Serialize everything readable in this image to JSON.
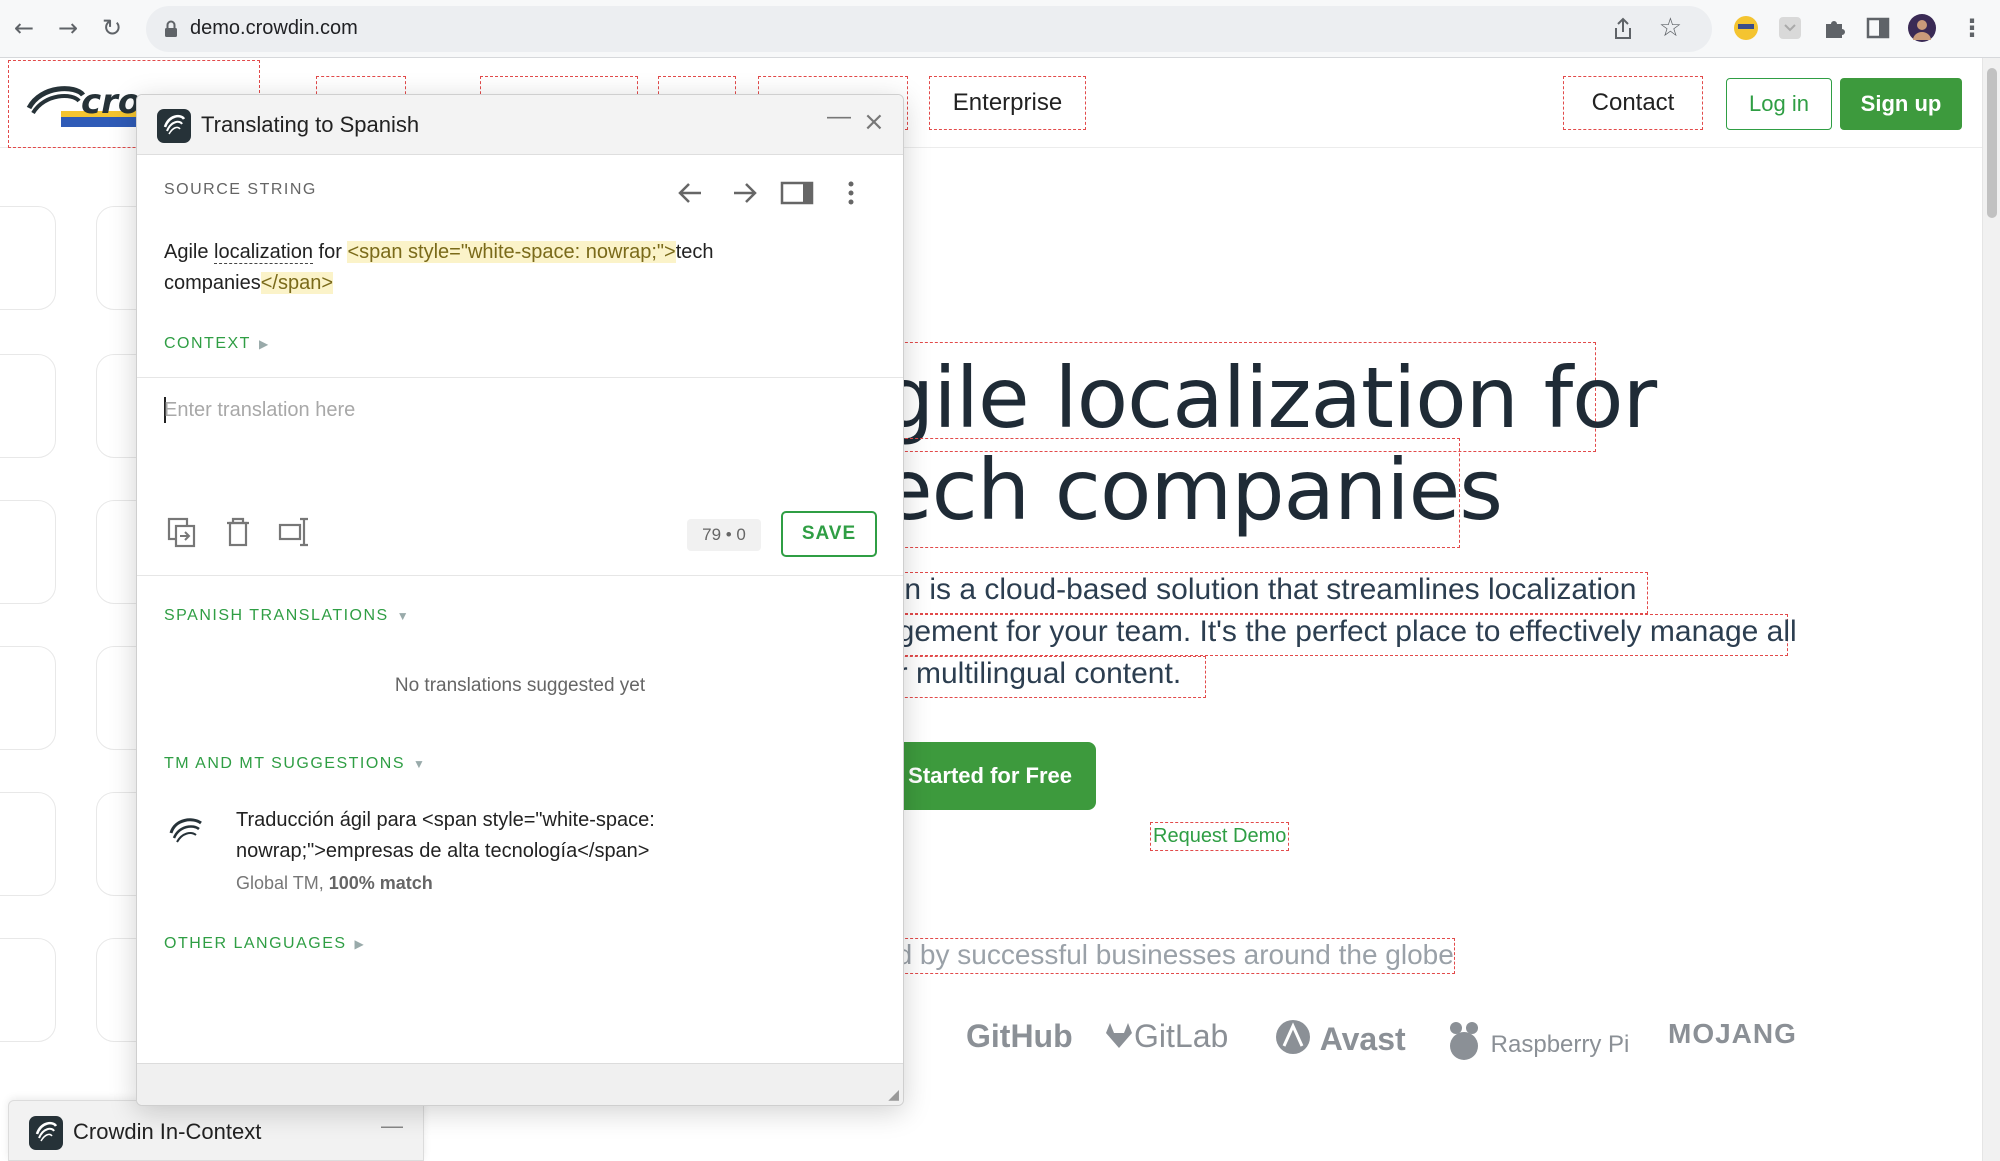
{
  "browser": {
    "url": "demo.crowdin.com",
    "back_icon": "←",
    "forward_icon": "→",
    "reload_icon": "↻",
    "star_icon": "☆",
    "menu_icon": "⋮"
  },
  "site": {
    "nav": {
      "enterprise": "Enterprise",
      "contact": "Contact",
      "login": "Log in",
      "signup": "Sign up"
    },
    "hero": {
      "line1": "gile localization for",
      "line2": "ech companies",
      "sub1": "din is a cloud-based solution that streamlines localization",
      "sub2": "agement for your team. It's the perfect place to effectively manage all",
      "sub3": "ur multilingual content.",
      "cta": ": Started for Free",
      "demo": "Request Demo",
      "trusted": "ed by successful businesses around the globe"
    },
    "brands": [
      "GitHub",
      "GitLab",
      "Avast",
      "Raspberry Pi",
      "MOJANG"
    ]
  },
  "dock": {
    "title": "Crowdin In-Context",
    "minimize": "—"
  },
  "dialog": {
    "title": "Translating to Spanish",
    "minimize": "—",
    "close": "×",
    "source_label": "SOURCE STRING",
    "source": {
      "part1": "Agile ",
      "part2": "localization",
      "part3": " for ",
      "tag_open": "<span style=\"white-space: nowrap;\">",
      "part4": "tech companies",
      "tag_close": "</span>"
    },
    "context_label": "CONTEXT",
    "placeholder": "Enter translation here",
    "counter": "79 • 0",
    "save": "SAVE",
    "spanish_label": "SPANISH TRANSLATIONS",
    "no_translations": "No translations suggested yet",
    "tm_label": "TM AND MT SUGGESTIONS",
    "tm_text": "Traducción ágil para <span style=\"white-space: nowrap;\">empresas de alta tecnología</span>",
    "tm_source": "Global TM, ",
    "tm_match": "100% match",
    "other_label": "OTHER LANGUAGES",
    "expand_icon": "▶",
    "collapse_icon": "▼"
  },
  "colors": {
    "accent_green": "#2f9e44",
    "dark": "#1f2b36",
    "dashed_red": "#e24a4a"
  }
}
